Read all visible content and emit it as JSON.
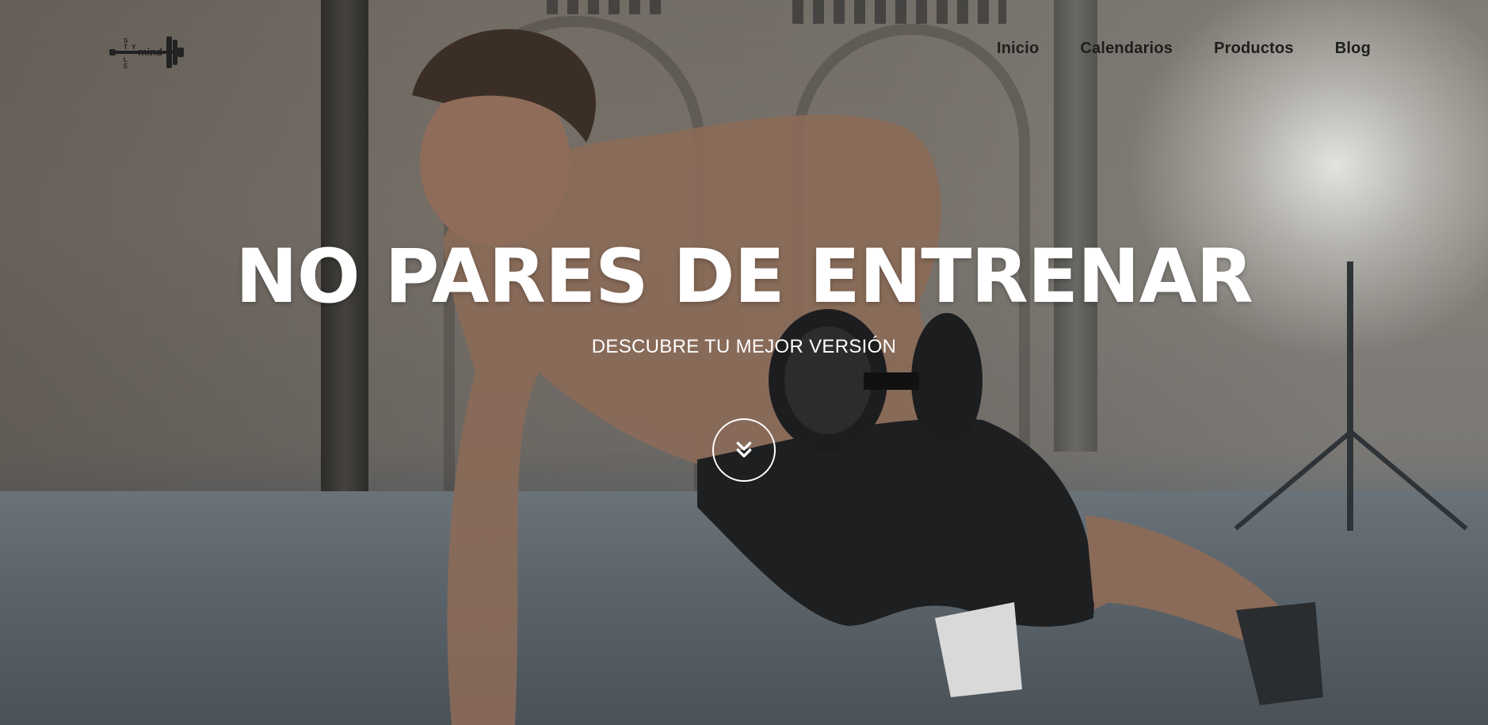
{
  "brand": {
    "logo_name": "Stylemind",
    "logo_text": "mind",
    "logo_stack_letters": [
      "S",
      "T",
      "Y",
      "L",
      "E"
    ]
  },
  "nav": {
    "items": [
      {
        "label": "Inicio"
      },
      {
        "label": "Calendarios"
      },
      {
        "label": "Productos"
      },
      {
        "label": "Blog"
      }
    ]
  },
  "hero": {
    "title": "NO PARES DE ENTRENAR",
    "subtitle": "DESCUBRE TU MEJOR VERSIÓN",
    "scroll_icon": "double-chevron-down-icon"
  },
  "colors": {
    "text_light": "#ffffff",
    "nav_text": "#1e1e1e"
  }
}
